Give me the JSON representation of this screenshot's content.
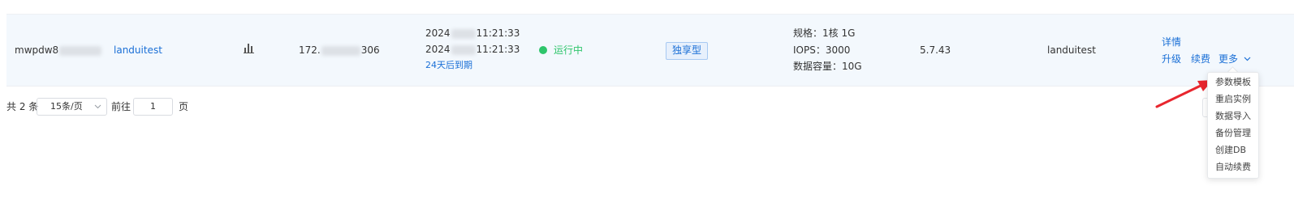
{
  "row": {
    "instance_id": "mwpdw8",
    "name": "landuitest",
    "ip_prefix": "172.",
    "ip_suffix": "306",
    "date_prefix": "2024",
    "created_time": "11:21:33",
    "expire_time": "11:21:33",
    "expire_note": "24天后到期",
    "status": "运行中",
    "type": "独享型",
    "spec_label": "规格：",
    "spec_value": "1核 1G",
    "iops_label": "IOPS：",
    "iops_value": "3000",
    "storage_label": "数据容量：",
    "storage_value": "10G",
    "version": "5.7.43",
    "account": "landuitest",
    "actions": {
      "detail": "详情",
      "upgrade": "升级",
      "renew": "续费",
      "more": "更多"
    }
  },
  "more_menu": [
    "参数模板",
    "重启实例",
    "数据导入",
    "备份管理",
    "创建DB",
    "自动续费"
  ],
  "pagination": {
    "total_prefix": "共 2 条",
    "page_size": "15条/页",
    "goto_label": "前往",
    "page": "1",
    "page_suffix": "页"
  },
  "colors": {
    "link": "#1a6fd6",
    "status_running": "#2ec56b",
    "row_background": "#f3f8fd",
    "annotation_arrow": "#e8262e"
  }
}
